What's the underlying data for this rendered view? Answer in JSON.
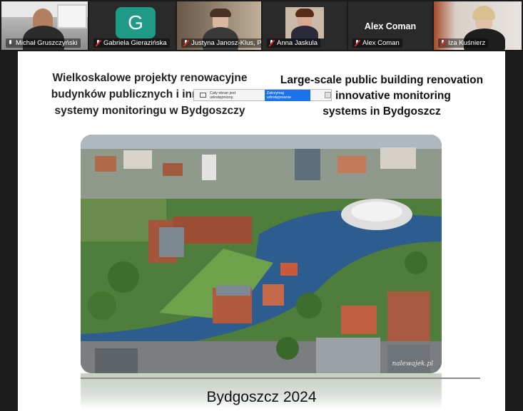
{
  "participants": [
    {
      "name": "Michał Gruszczyński",
      "muted": false,
      "active": true,
      "avatar": "video"
    },
    {
      "name": "Gabriela Gierazińska",
      "muted": true,
      "active": false,
      "avatar": "letter",
      "letter": "G"
    },
    {
      "name": "Justyna Janosz-Klus, P...",
      "muted": true,
      "active": false,
      "avatar": "video"
    },
    {
      "name": "Anna Jaskula",
      "muted": true,
      "active": false,
      "avatar": "video"
    },
    {
      "name": "Alex Coman",
      "muted": true,
      "active": false,
      "avatar": "text",
      "display": "Alex Coman"
    },
    {
      "name": "Iza Kuśnierz",
      "muted": true,
      "active": false,
      "avatar": "video"
    }
  ],
  "slide": {
    "title_pl": [
      "Wielkoskalowe projekty renowacyjne",
      "budynków publicznych i innowacyjne",
      "systemy monitoringu w Bydgoszczy"
    ],
    "title_en": [
      "Large-scale public building renovation",
      "and innovative monitoring",
      "systems in Bydgoszcz"
    ],
    "photo_credit": "nalewajek.pl",
    "footer": "Bydgoszcz 2024"
  },
  "share_bar": {
    "status": "Cały ekran jest udostępniony.",
    "stop_label": "Zatrzymaj udostępnianie"
  },
  "colors": {
    "active_speaker": "#25c25a",
    "muted_icon": "#e02828",
    "letter_avatar": "#1e9a86",
    "stop_button": "#1a73e8"
  }
}
